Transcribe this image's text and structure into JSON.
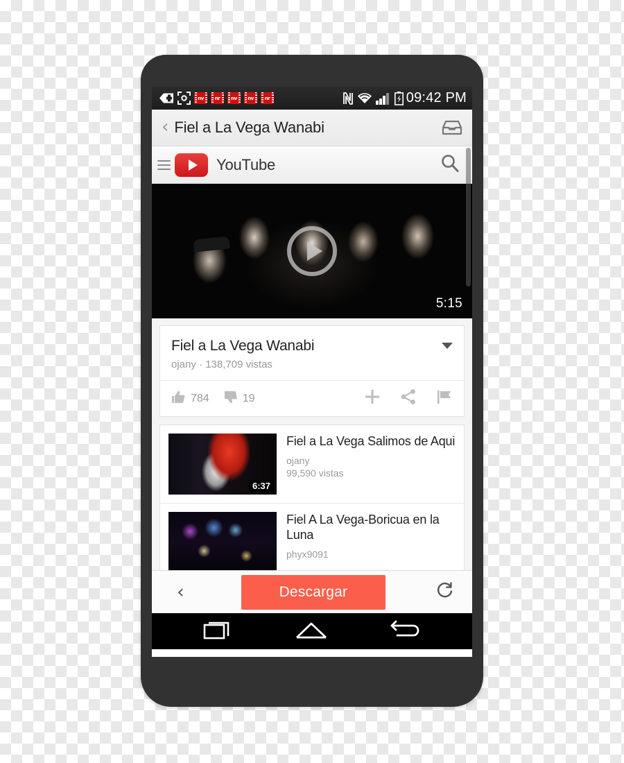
{
  "status_bar": {
    "icons": [
      "back-tag-icon",
      "screenshot-focus-icon",
      "movie-badge-1",
      "movie-badge-2",
      "movie-badge-3",
      "movie-badge-4",
      "movie-badge-5"
    ],
    "movie_labels": [
      "nv",
      "nr",
      "nv",
      "nv",
      "nr"
    ],
    "right_icons": [
      "nfc-icon",
      "wifi-icon",
      "signal-icon",
      "battery-charging-icon"
    ],
    "clock": "09:42 PM"
  },
  "app_bar": {
    "back_label": "‹",
    "title": "Fiel a La Vega Wanabi",
    "right_icon": "inbox-tray-icon"
  },
  "yt_header": {
    "menu_icon": "hamburger-menu-icon",
    "logo_icon": "youtube-logo-icon",
    "brand": "YouTube",
    "search_icon": "search-icon"
  },
  "player": {
    "play_icon": "play-circle-icon",
    "duration": "5:15"
  },
  "video_info": {
    "title": "Fiel a La Vega Wanabi",
    "channel": "ojany",
    "separator": "·",
    "views": "138,709 vistas",
    "expand_icon": "chevron-down-icon",
    "likes": "784",
    "dislikes": "19",
    "like_icon": "thumbs-up-icon",
    "dislike_icon": "thumbs-down-icon",
    "add_icon": "plus-icon",
    "share_icon": "share-icon",
    "flag_icon": "flag-icon"
  },
  "related": [
    {
      "title": "Fiel a La Vega Salimos de Aqui",
      "channel": "ojany",
      "views": "99,590 vistas",
      "duration": "6:37"
    },
    {
      "title": "Fiel A La Vega-Boricua en la Luna",
      "channel": "phyx9091",
      "views": "",
      "duration": ""
    }
  ],
  "download_bar": {
    "prev_label": "‹",
    "download_label": "Descargar",
    "reload_icon": "reload-icon",
    "accent_color": "#fb5e4a"
  },
  "nav_bar": {
    "recents_icon": "recents-icon",
    "home_icon": "home-icon",
    "back_icon": "back-arrow-icon"
  }
}
